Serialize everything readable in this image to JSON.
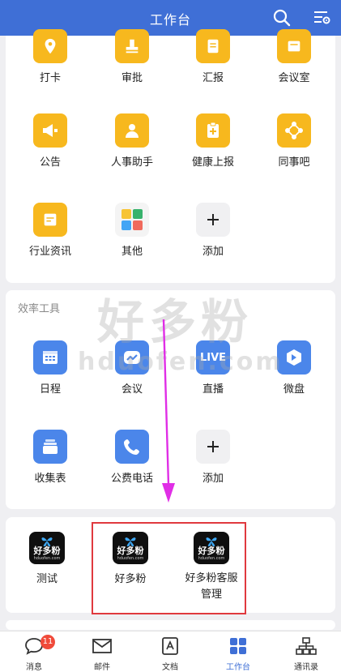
{
  "header": {
    "title": "工作台",
    "search_icon": "search-icon",
    "filter_icon": "filter-settings-icon",
    "color": "#3f6fd6"
  },
  "section1": {
    "apps": [
      {
        "label": "打卡",
        "icon": "location-pin-icon"
      },
      {
        "label": "审批",
        "icon": "stamp-icon"
      },
      {
        "label": "汇报",
        "icon": "report-icon"
      },
      {
        "label": "会议室",
        "icon": "meeting-room-icon"
      },
      {
        "label": "公告",
        "icon": "megaphone-icon"
      },
      {
        "label": "人事助手",
        "icon": "person-icon"
      },
      {
        "label": "健康上报",
        "icon": "health-clipboard-icon"
      },
      {
        "label": "同事吧",
        "icon": "network-icon"
      },
      {
        "label": "行业资讯",
        "icon": "news-icon"
      },
      {
        "label": "其他",
        "icon": "grid-apps-icon"
      },
      {
        "label": "添加",
        "icon": "plus-icon"
      }
    ]
  },
  "section2": {
    "title": "效率工具",
    "apps": [
      {
        "label": "日程",
        "icon": "calendar-icon"
      },
      {
        "label": "会议",
        "icon": "video-meeting-icon"
      },
      {
        "label": "直播",
        "icon": "live-icon",
        "icon_text": "LIVE"
      },
      {
        "label": "微盘",
        "icon": "cloud-disk-icon"
      },
      {
        "label": "收集表",
        "icon": "form-stack-icon"
      },
      {
        "label": "公费电话",
        "icon": "phone-icon"
      },
      {
        "label": "添加",
        "icon": "plus-icon"
      }
    ]
  },
  "section3": {
    "apps": [
      {
        "label": "测试",
        "icon": "haoduofen-logo-icon"
      },
      {
        "label": "好多粉",
        "icon": "haoduofen-logo-icon"
      },
      {
        "label": "好多粉客服管理",
        "label_line1": "好多粉客服",
        "label_line2": "管理",
        "icon": "haoduofen-logo-icon"
      }
    ],
    "logo_text": "好多粉",
    "logo_subtext": "hduofen.com"
  },
  "watermark": {
    "line1": "好多粉",
    "line2": "hduofen.com"
  },
  "nav": [
    {
      "label": "消息",
      "icon": "chat-bubble-icon",
      "badge": "11"
    },
    {
      "label": "邮件",
      "icon": "mail-icon"
    },
    {
      "label": "文档",
      "icon": "document-icon"
    },
    {
      "label": "工作台",
      "icon": "workbench-grid-icon",
      "active": true
    },
    {
      "label": "通讯录",
      "icon": "org-chart-icon"
    }
  ]
}
